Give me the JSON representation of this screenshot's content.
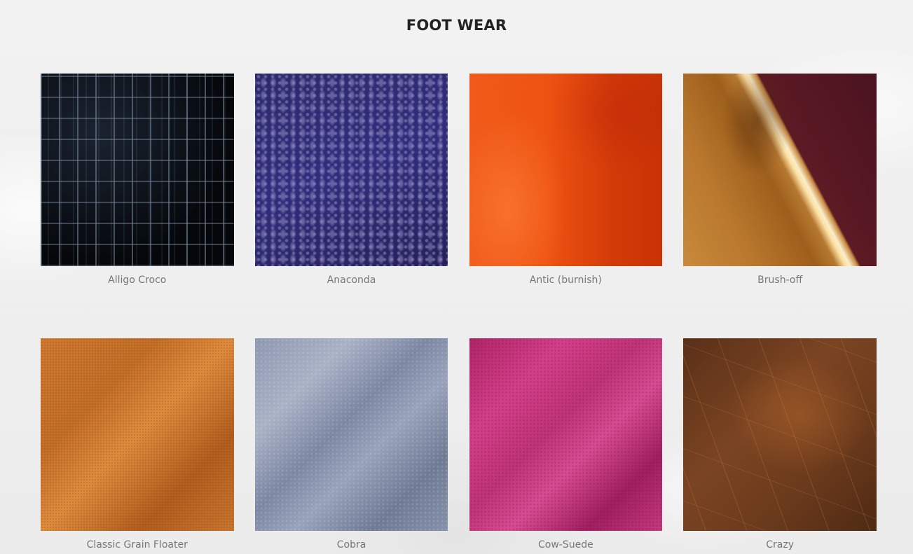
{
  "section": {
    "title": "FOOT WEAR"
  },
  "materials": [
    {
      "label": "Alligo Croco",
      "texture": "black-croc-leather"
    },
    {
      "label": "Anaconda",
      "texture": "navy-snake-leather"
    },
    {
      "label": "Antic (burnish)",
      "texture": "orange-burnished-leather"
    },
    {
      "label": "Brush-off",
      "texture": "tan-burgundy-brushoff-leather"
    },
    {
      "label": "Classic Grain Floater",
      "texture": "tan-pebble-grain-leather"
    },
    {
      "label": "Cobra",
      "texture": "grey-blue-suede"
    },
    {
      "label": "Cow-Suede",
      "texture": "magenta-suede"
    },
    {
      "label": "Crazy",
      "texture": "brown-crazy-horse-leather"
    }
  ],
  "colors": {
    "background": "#efefef",
    "title": "#222222",
    "caption": "#777777"
  }
}
